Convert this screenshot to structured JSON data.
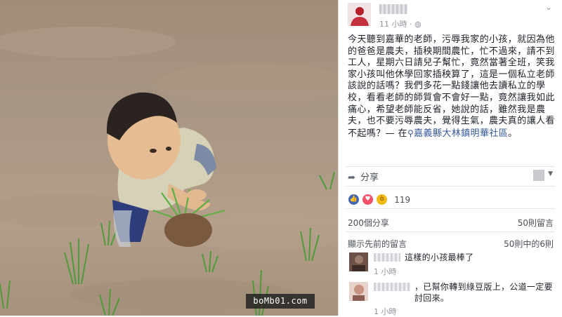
{
  "watermark": "boMb01.com",
  "post": {
    "poster_name": "",
    "time": "11 小時 · ",
    "globe_icon": "globe-icon",
    "text_line1": "今天聽到嘉華的老師，污辱我家的小孩，就因為他的爸爸是農夫，插秧期間農忙，忙不過來，請不到工人，星期六日請兒子幫忙，竟然當著全班，笑我家小孩叫他休學回家插秧算了，這是一個私立老師該說的話嗎？我們多花一點錢讓他去讀私立的學校，看看老師的師質會不會好一點，竟然讓我如此痛心，希望老師能反省，她說的話，雖然我是農夫，也不要污辱農夫，覺得生氣，農夫真的讓人看不起嗎？— 在",
    "location": "嘉義縣大林鎮明華社區",
    "location_suffix": "。",
    "share_label": "分享",
    "reaction_count": "119",
    "shares": "200個分享",
    "comments_count": "50則留言",
    "prev_comments": "顯示先前的留言",
    "comments_range": "50則中的6則",
    "comments": [
      {
        "text": "這樣的小孩最棒了",
        "time": "1 小時"
      },
      {
        "text": "，已幫你轉到綠豆版上，公道一定要討回來。",
        "time": "1 小時"
      }
    ]
  },
  "colors": {
    "link": "#365899",
    "meta": "#90949c",
    "like": "#4267b2"
  }
}
